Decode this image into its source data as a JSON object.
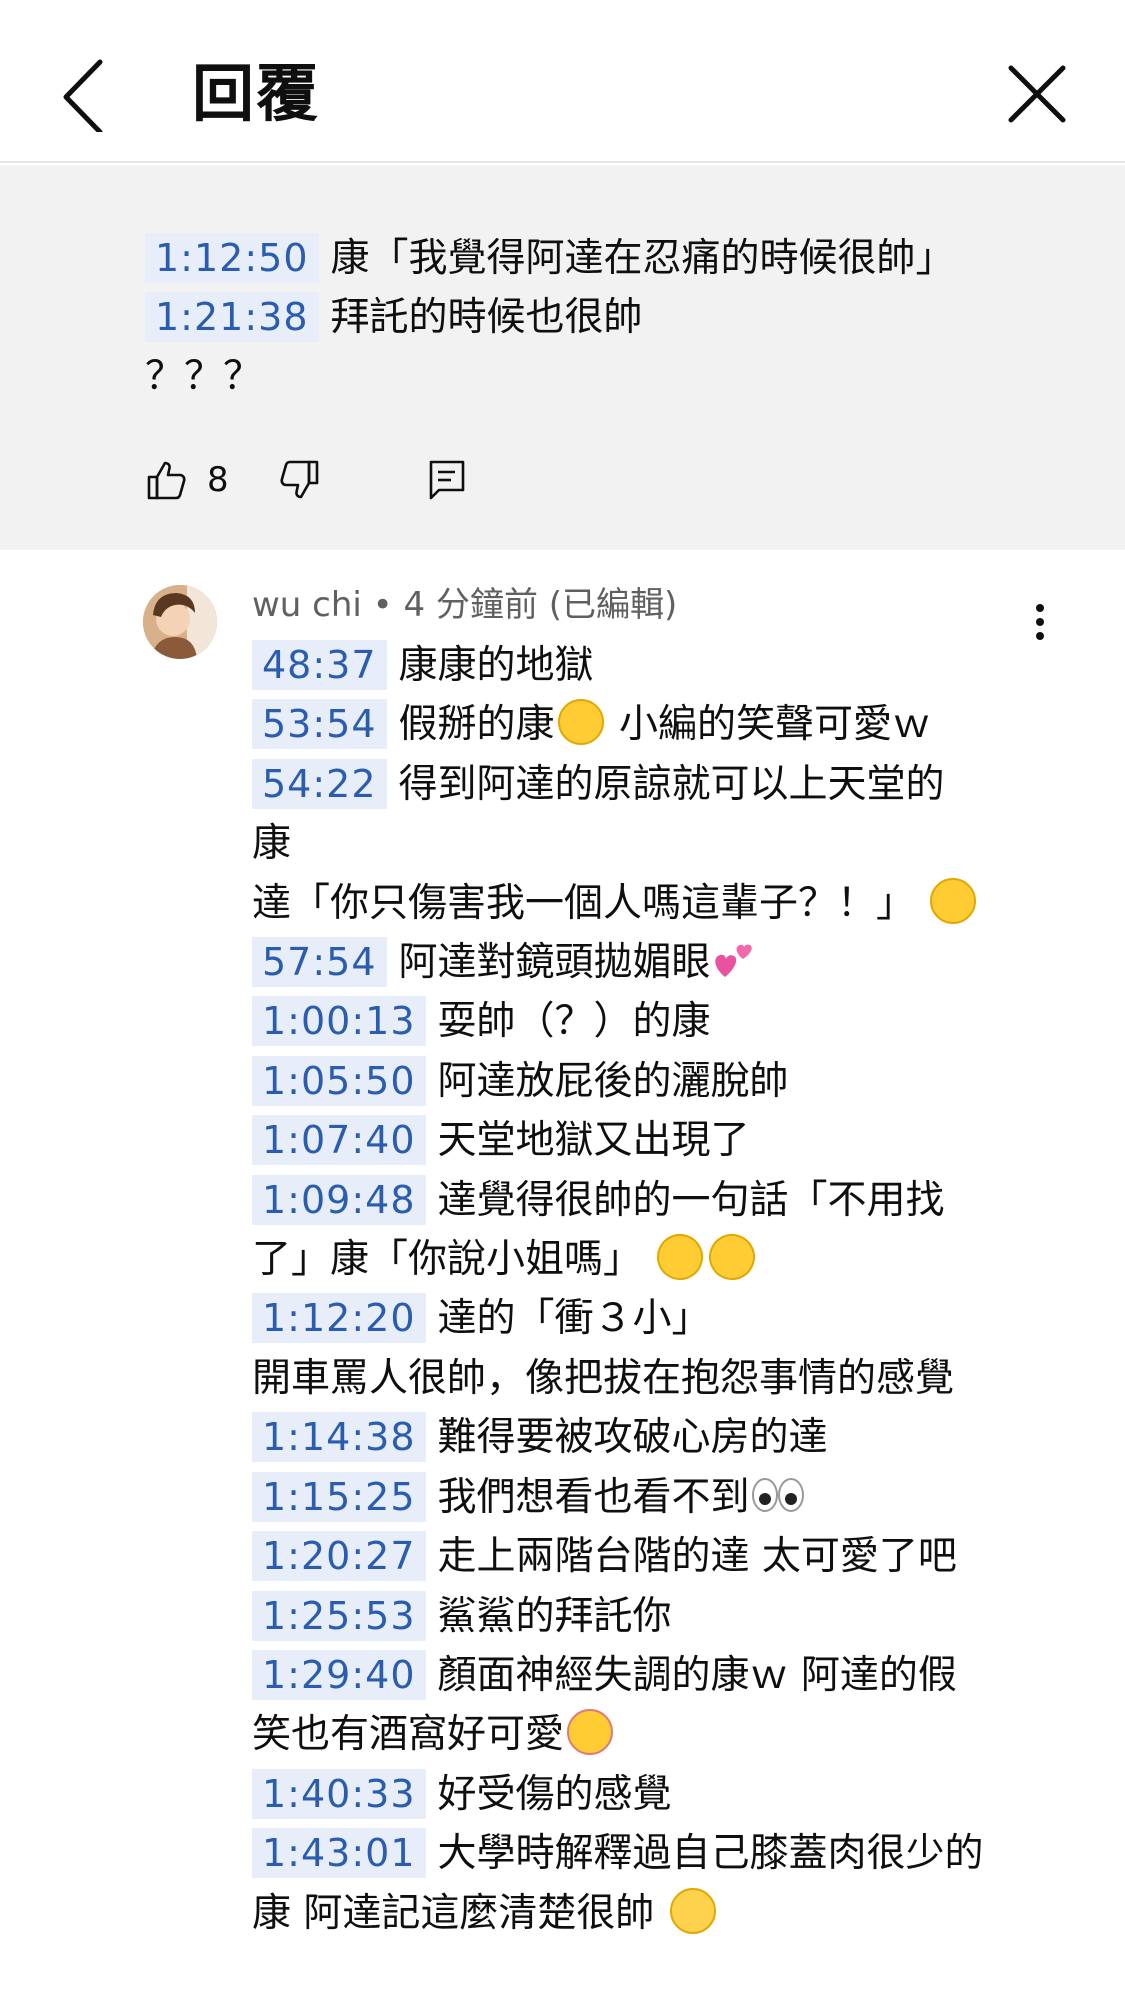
{
  "header": {
    "title": "回覆"
  },
  "parent_comment": {
    "lines": [
      {
        "timestamp": "1:12:50",
        "text": "康「我覺得阿達在忍痛的時候很帥」"
      },
      {
        "timestamp": "1:21:38",
        "text": "拜託的時候也很帥"
      },
      {
        "timestamp": "",
        "text": "？？？"
      }
    ],
    "like_count": "8"
  },
  "reply": {
    "author": "wu chi",
    "separator": "•",
    "time": "4 分鐘前 (已編輯)",
    "lines": [
      {
        "timestamp": "48:37",
        "text": "康康的地獄"
      },
      {
        "timestamp": "53:54",
        "text": "假掰的康",
        "emoji": "face-with-tears-of-joy",
        "text2": "小編的笑聲可愛ｗ"
      },
      {
        "timestamp": "54:22",
        "text": "得到阿達的原諒就可以上天堂的"
      },
      {
        "timestamp": "",
        "text": "康"
      },
      {
        "timestamp": "",
        "text": "達「你只傷害我一個人嗎這輩子？！」",
        "emoji": "face-with-tears-of-joy"
      },
      {
        "timestamp": "57:54",
        "text": "阿達對鏡頭拋媚眼",
        "emoji": "two-hearts"
      },
      {
        "timestamp": "1:00:13",
        "text": "耍帥（？）的康"
      },
      {
        "timestamp": "1:05:50",
        "text": "阿達放屁後的灑脫帥"
      },
      {
        "timestamp": "1:07:40",
        "text": "天堂地獄又出現了"
      },
      {
        "timestamp": "1:09:48",
        "text": "達覺得很帥的一句話「不用找"
      },
      {
        "timestamp": "",
        "text": "了」康「你說小姐嗎」",
        "emoji": "rolling-on-the-floor-laughing",
        "emoji2": "rolling-on-the-floor-laughing"
      },
      {
        "timestamp": "1:12:20",
        "text": "達的「衝３小」"
      },
      {
        "timestamp": "",
        "text": "開車罵人很帥，像把拔在抱怨事情的感覺"
      },
      {
        "timestamp": "1:14:38",
        "text": "難得要被攻破心房的達"
      },
      {
        "timestamp": "1:15:25",
        "text": "我們想看也看不到",
        "emoji": "eyes"
      },
      {
        "timestamp": "1:20:27",
        "text": "走上兩階台階的達 太可愛了吧"
      },
      {
        "timestamp": "1:25:53",
        "text": "鯊鯊的拜託你"
      },
      {
        "timestamp": "1:29:40",
        "text": "顏面神經失調的康ｗ 阿達的假"
      },
      {
        "timestamp": "",
        "text": "笑也有酒窩好可愛",
        "emoji": "smiling-face-with-hearts"
      },
      {
        "timestamp": "1:40:33",
        "text": "好受傷的感覺"
      },
      {
        "timestamp": "1:43:01",
        "text": "大學時解釋過自己膝蓋肉很少的"
      },
      {
        "timestamp": "",
        "text": "康 阿達記這麼清楚很帥",
        "emoji": "relieved-face"
      }
    ]
  },
  "colors": {
    "timestamp_text": "#2a5db0",
    "timestamp_bg": "#e8eef9",
    "parent_bg": "#f2f2f2",
    "meta_text": "#606060"
  }
}
